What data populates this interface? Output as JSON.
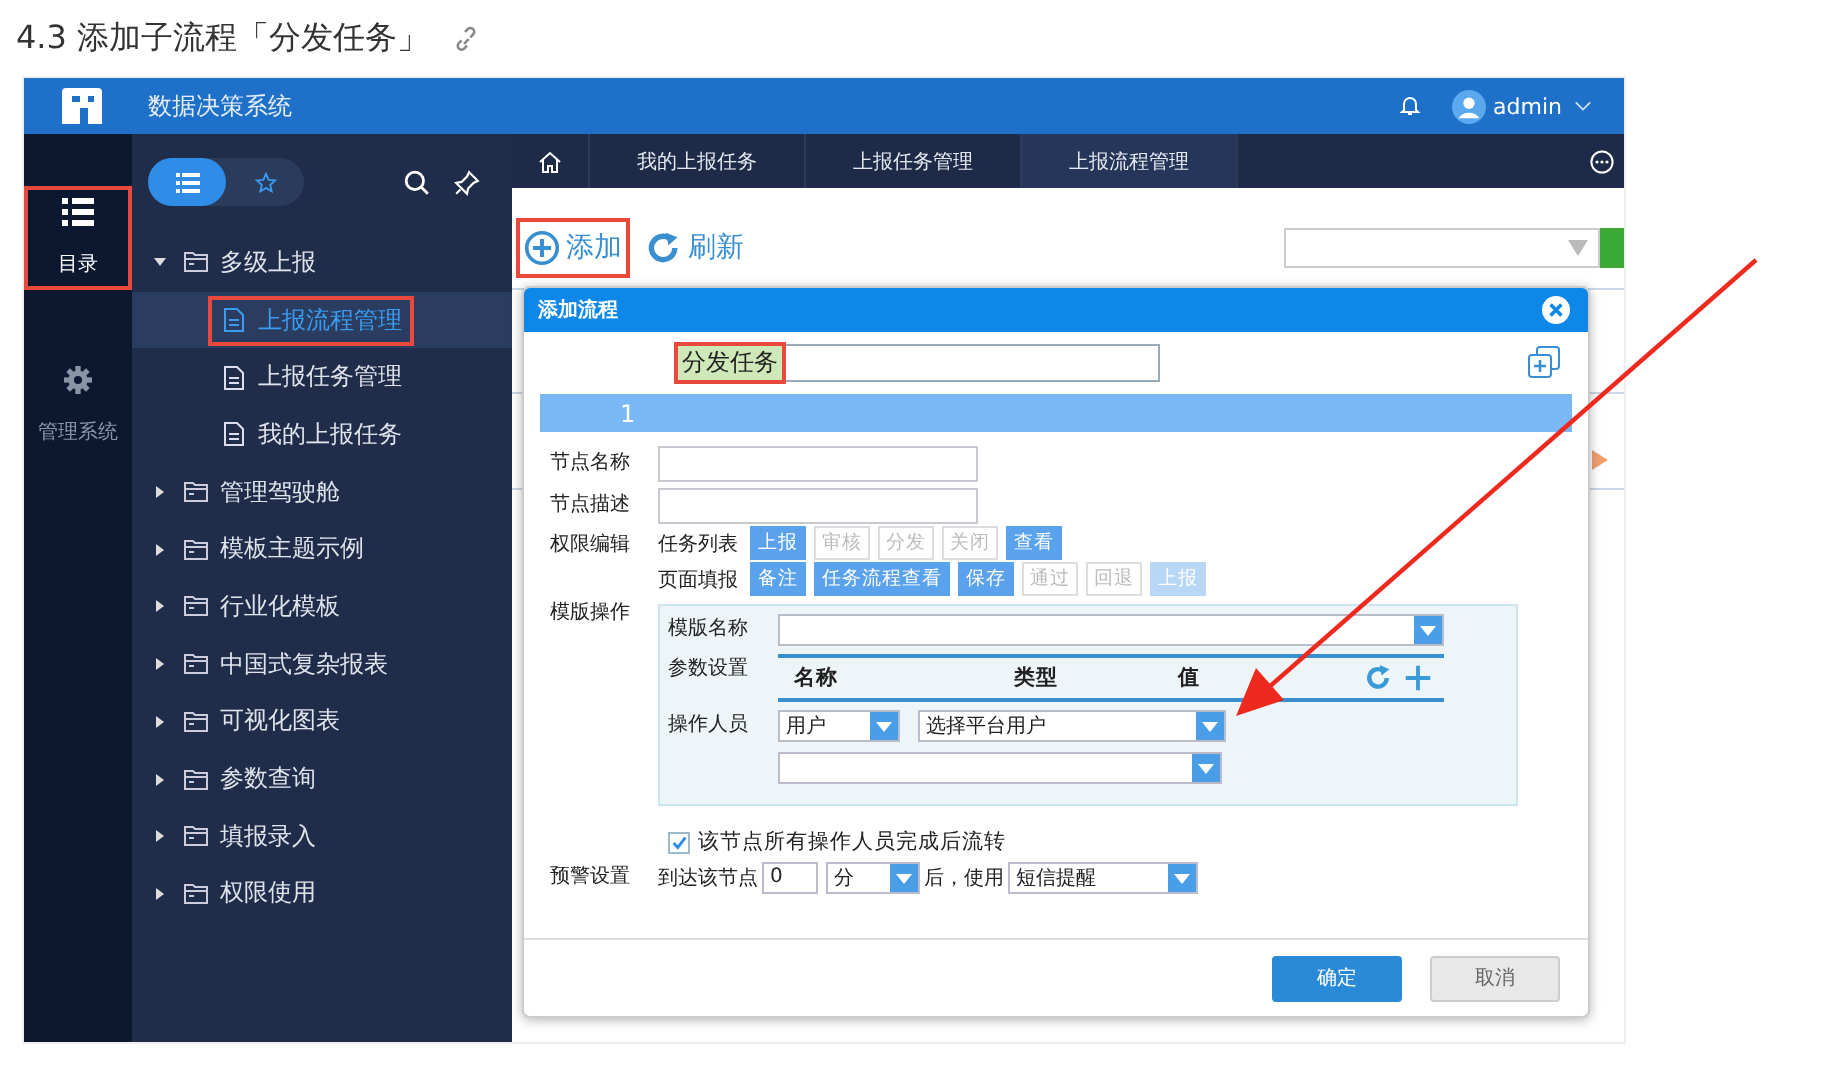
{
  "heading": {
    "text": "4.3 添加子流程「分发任务」"
  },
  "app": {
    "title": "数据决策系统",
    "user": "admin",
    "rail": [
      {
        "label": "目录",
        "selected": true,
        "callout": true
      },
      {
        "label": "管理系统",
        "selected": false,
        "callout": false
      }
    ],
    "view_toggle": [
      {
        "selected": true
      },
      {
        "selected": false
      }
    ],
    "tree": [
      {
        "label": "多级上报",
        "expanded": true,
        "children": [
          {
            "label": "上报流程管理",
            "selected": true,
            "callout": true
          },
          {
            "label": "上报任务管理",
            "selected": false,
            "callout": false
          },
          {
            "label": "我的上报任务",
            "selected": false,
            "callout": false
          }
        ]
      },
      {
        "label": "管理驾驶舱",
        "expanded": false
      },
      {
        "label": "模板主题示例",
        "expanded": false
      },
      {
        "label": "行业化模板",
        "expanded": false
      },
      {
        "label": "中国式复杂报表",
        "expanded": false
      },
      {
        "label": "可视化图表",
        "expanded": false
      },
      {
        "label": "参数查询",
        "expanded": false
      },
      {
        "label": "填报录入",
        "expanded": false
      },
      {
        "label": "权限使用",
        "expanded": false
      }
    ],
    "tabs": [
      {
        "label": "我的上报任务",
        "selected": false
      },
      {
        "label": "上报任务管理",
        "selected": false
      },
      {
        "label": "上报流程管理",
        "selected": true
      }
    ],
    "toolbar": [
      {
        "label": "添加",
        "callout": true
      },
      {
        "label": "刷新",
        "callout": false
      }
    ],
    "dialog": {
      "title": "添加流程",
      "flow_name": {
        "value": "分发任务",
        "callout": true
      },
      "step": "1",
      "fields": [
        {
          "label": "节点名称"
        },
        {
          "label": "节点描述"
        }
      ],
      "permissions": {
        "label": "权限编辑",
        "groups": [
          {
            "label": "任务列表",
            "tags": [
              {
                "text": "上报",
                "selected": true,
                "disabled": false
              },
              {
                "text": "审核",
                "selected": false,
                "disabled": false
              },
              {
                "text": "分发",
                "selected": false,
                "disabled": false
              },
              {
                "text": "关闭",
                "selected": false,
                "disabled": false
              },
              {
                "text": "查看",
                "selected": true,
                "disabled": false
              }
            ]
          },
          {
            "label": "页面填报",
            "tags": [
              {
                "text": "备注",
                "selected": true,
                "disabled": false
              },
              {
                "text": "任务流程查看",
                "selected": true,
                "disabled": false
              },
              {
                "text": "保存",
                "selected": true,
                "disabled": false
              },
              {
                "text": "通过",
                "selected": false,
                "disabled": false
              },
              {
                "text": "回退",
                "selected": false,
                "disabled": false
              },
              {
                "text": "上报",
                "selected": true,
                "disabled": true
              }
            ]
          }
        ]
      },
      "template": {
        "label": "模版操作",
        "name_label": "模版名称",
        "params_label": "参数设置",
        "param_columns": [
          "名称",
          "类型",
          "值"
        ],
        "operator_label": "操作人员",
        "operator_type": "用户",
        "operator_select": "选择平台用户"
      },
      "all_complete": {
        "label": "该节点所有操作人员完成后流转",
        "checked": true
      },
      "warning": {
        "label": "预警设置",
        "prefix": "到达该节点",
        "amount": "0",
        "unit": "分",
        "middle": "后，使用",
        "method": "短信提醒"
      },
      "buttons": [
        {
          "label": "确定",
          "primary": true
        },
        {
          "label": "取消",
          "primary": false
        }
      ]
    }
  }
}
